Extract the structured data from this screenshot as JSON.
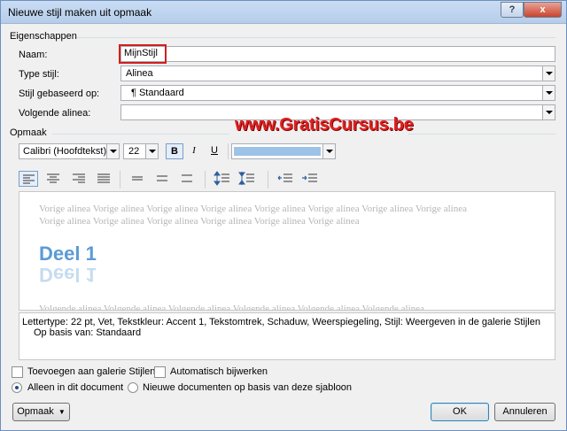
{
  "window": {
    "title": "Nieuwe stijl maken uit opmaak",
    "help": "?",
    "close": "x"
  },
  "properties": {
    "group_label": "Eigenschappen",
    "name_label": "Naam:",
    "name_value": "MijnStijl",
    "type_label": "Type stijl:",
    "type_value": "Alinea",
    "based_on_label": "Stijl gebaseerd op:",
    "based_on_value": "¶ Standaard",
    "next_label": "Volgende alinea:",
    "next_value": ""
  },
  "formatting": {
    "group_label": "Opmaak",
    "font_value": "Calibri (Hoofdtekst)",
    "size_value": "22",
    "bold": "B",
    "italic": "I",
    "underline": "U",
    "color_value": "accent-1-blue",
    "color_hex": "#9dc3e6"
  },
  "watermark": "www.GratisCursus.be",
  "preview": {
    "prev_line1": "Vorige alinea Vorige alinea Vorige alinea Vorige alinea Vorige alinea Vorige alinea Vorige alinea Vorige alinea",
    "prev_line2": "Vorige alinea Vorige alinea Vorige alinea Vorige alinea Vorige alinea Vorige alinea",
    "heading": "Deel 1",
    "next_line": "Volgende alinea Volgende alinea Volgende alinea Volgende alinea Volgende alinea Volgende alinea"
  },
  "description": {
    "line1": "Lettertype: 22 pt, Vet, Tekstkleur: Accent 1, Tekstomtrek, Schaduw, Weerspiegeling, Stijl: Weergeven in de galerie Stijlen",
    "line2": "Op basis van: Standaard"
  },
  "options": {
    "add_gallery": "Toevoegen aan galerie Stijlen",
    "auto_update": "Automatisch bijwerken",
    "only_doc": "Alleen in dit document",
    "new_docs": "Nieuwe documenten op basis van deze sjabloon"
  },
  "buttons": {
    "format": "Opmaak",
    "ok": "OK",
    "cancel": "Annuleren"
  }
}
